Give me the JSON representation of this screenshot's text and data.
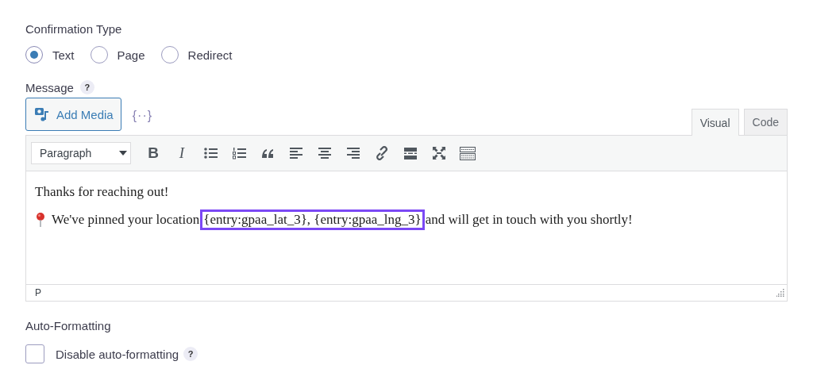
{
  "confirmation_type": {
    "label": "Confirmation Type",
    "options": [
      {
        "label": "Text",
        "selected": true
      },
      {
        "label": "Page",
        "selected": false
      },
      {
        "label": "Redirect",
        "selected": false
      }
    ]
  },
  "message": {
    "label": "Message",
    "help": "?",
    "add_media": "Add Media",
    "merge_tags": "{··}",
    "tabs": [
      {
        "label": "Visual",
        "selected": true
      },
      {
        "label": "Code",
        "selected": false
      }
    ],
    "format": "Paragraph",
    "toolbar": [
      {
        "kind": "bold",
        "label": "B"
      },
      {
        "kind": "italic",
        "label": "I"
      },
      {
        "kind": "bullets"
      },
      {
        "kind": "numbers"
      },
      {
        "kind": "quote"
      },
      {
        "kind": "align-left"
      },
      {
        "kind": "align-center"
      },
      {
        "kind": "align-right"
      },
      {
        "kind": "link"
      },
      {
        "kind": "more"
      },
      {
        "kind": "fullscreen"
      },
      {
        "kind": "kitchen-sink"
      }
    ],
    "content": [
      {
        "kind": "plain",
        "text": "Thanks for reaching out!"
      },
      {
        "kind": "pinned",
        "before": "We've pinned your location",
        "highlight": "{entry:gpaa_lat_3}, {entry:gpaa_lng_3}",
        "after": "and will get in touch with you shortly!"
      }
    ],
    "path": "P"
  },
  "auto_formatting": {
    "label": "Auto-Formatting",
    "checkbox": {
      "label": "Disable auto-formatting",
      "checked": false
    },
    "help": "?"
  }
}
